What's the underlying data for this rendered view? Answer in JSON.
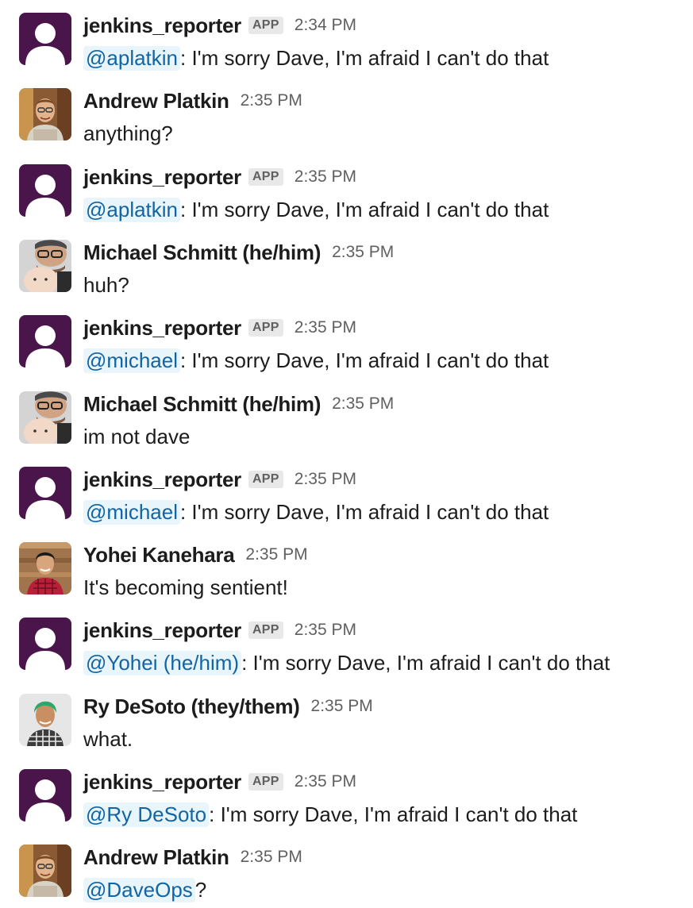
{
  "messages": [
    {
      "type": "bot",
      "author": "jenkins_reporter",
      "badge": "APP",
      "time": "2:34 PM",
      "mention": "@aplatkin",
      "text": ": I'm sorry Dave, I'm afraid I can't do that"
    },
    {
      "type": "user",
      "avatar": "andrew",
      "author": "Andrew Platkin",
      "time": "2:35 PM",
      "text": "anything?"
    },
    {
      "type": "bot",
      "author": "jenkins_reporter",
      "badge": "APP",
      "time": "2:35 PM",
      "mention": "@aplatkin",
      "text": ": I'm sorry Dave, I'm afraid I can't do that"
    },
    {
      "type": "user",
      "avatar": "michael",
      "author": "Michael Schmitt (he/him)",
      "time": "2:35 PM",
      "text": "huh?"
    },
    {
      "type": "bot",
      "author": "jenkins_reporter",
      "badge": "APP",
      "time": "2:35 PM",
      "mention": "@michael",
      "text": ": I'm sorry Dave, I'm afraid I can't do that"
    },
    {
      "type": "user",
      "avatar": "michael",
      "author": "Michael Schmitt (he/him)",
      "time": "2:35 PM",
      "text": "im not dave"
    },
    {
      "type": "bot",
      "author": "jenkins_reporter",
      "badge": "APP",
      "time": "2:35 PM",
      "mention": "@michael",
      "text": ": I'm sorry Dave, I'm afraid I can't do that"
    },
    {
      "type": "user",
      "avatar": "yohei",
      "author": "Yohei Kanehara",
      "time": "2:35 PM",
      "text": "It's becoming sentient!"
    },
    {
      "type": "bot",
      "author": "jenkins_reporter",
      "badge": "APP",
      "time": "2:35 PM",
      "mention": "@Yohei (he/him)",
      "text": ": I'm sorry Dave, I'm afraid I can't do that"
    },
    {
      "type": "user",
      "avatar": "ry",
      "author": "Ry DeSoto (they/them)",
      "time": "2:35 PM",
      "text": "what."
    },
    {
      "type": "bot",
      "author": "jenkins_reporter",
      "badge": "APP",
      "time": "2:35 PM",
      "mention": "@Ry DeSoto",
      "text": ": I'm sorry Dave, I'm afraid I can't do that"
    },
    {
      "type": "user",
      "avatar": "andrew",
      "author": "Andrew Platkin",
      "time": "2:35 PM",
      "mention": "@DaveOps",
      "text": "?"
    }
  ],
  "colors": {
    "bot_avatar": "#4a154b",
    "mention_bg": "#e8f5fa",
    "mention_text": "#1264a3",
    "timestamp": "#616061"
  }
}
